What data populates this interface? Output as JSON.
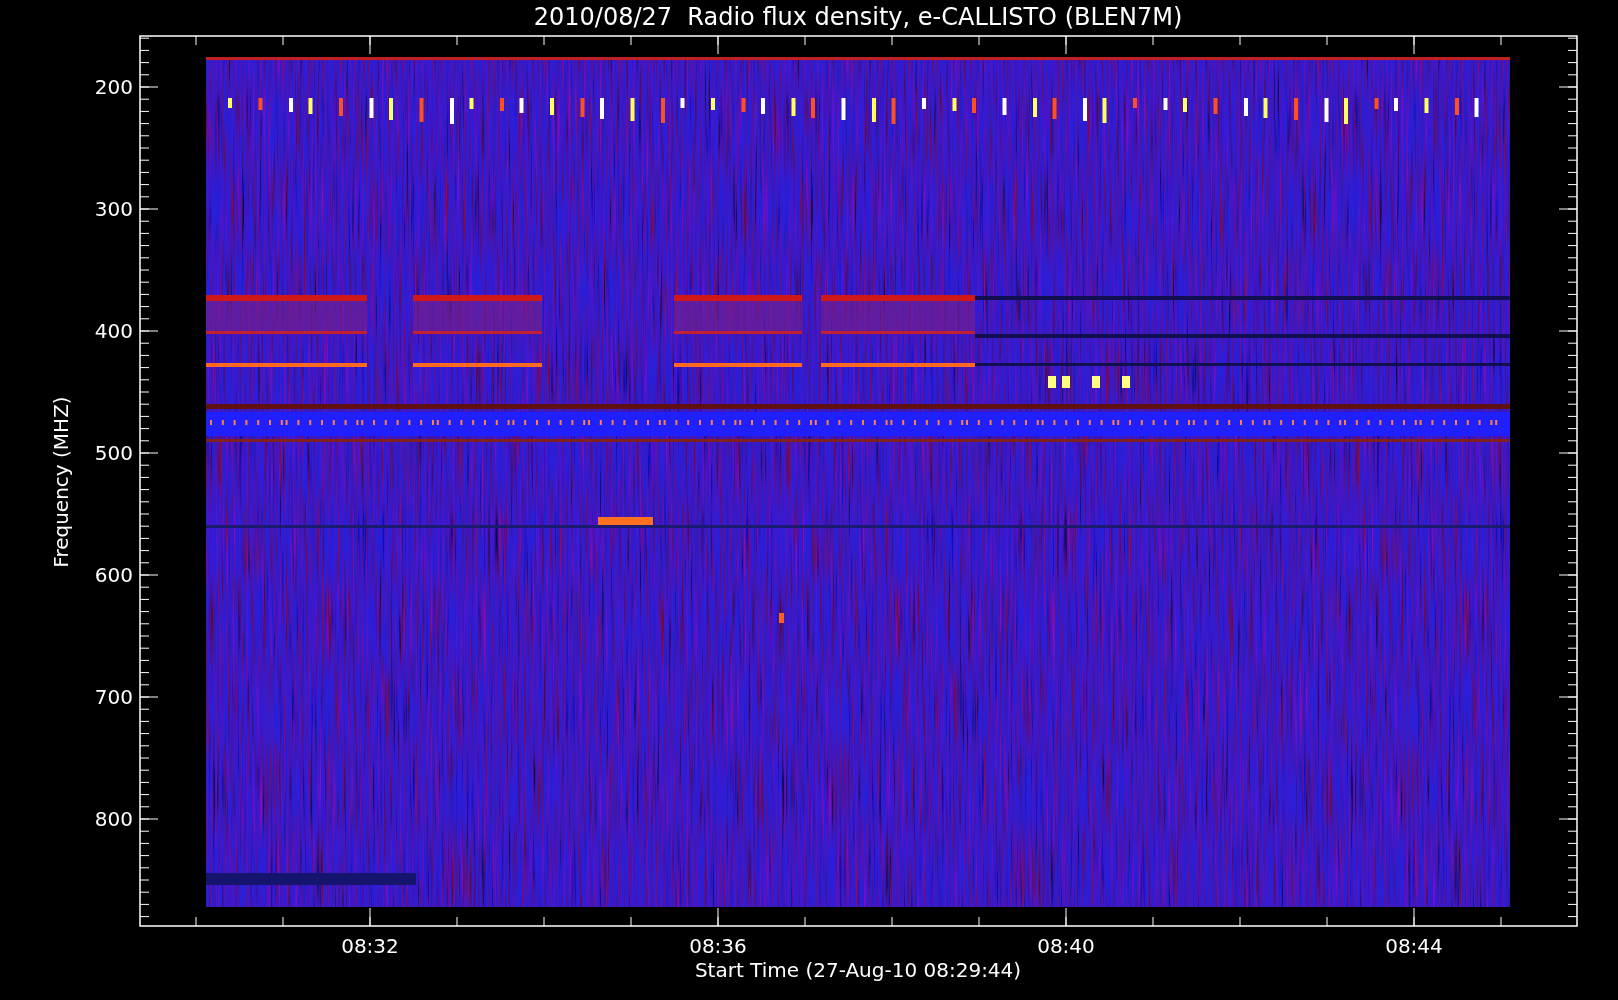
{
  "title": "2010/08/27  Radio flux density, e-CALLISTO (BLEN7M)",
  "y_axis": {
    "label": "Frequency (MHZ)",
    "ticks": [
      "200",
      "300",
      "400",
      "500",
      "600",
      "700",
      "800"
    ]
  },
  "x_axis": {
    "label": "Start Time (27-Aug-10 08:29:44)",
    "ticks": [
      "08:32",
      "08:36",
      "08:40",
      "08:44"
    ]
  }
}
